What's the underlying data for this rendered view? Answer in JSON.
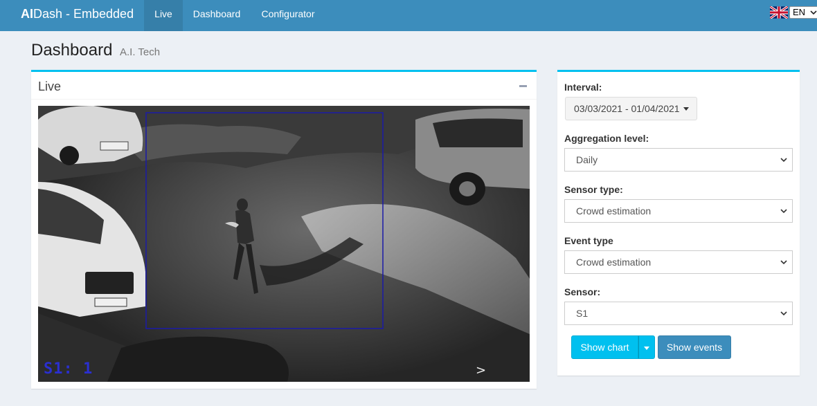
{
  "app": {
    "brand_bold": "AI",
    "brand_rest": "Dash - Embedded"
  },
  "nav": {
    "items": [
      {
        "label": "Live",
        "active": true
      },
      {
        "label": "Dashboard",
        "active": false
      },
      {
        "label": "Configurator",
        "active": false
      }
    ],
    "language": {
      "selected": "EN",
      "flag": "uk-flag-icon"
    }
  },
  "page": {
    "title": "Dashboard",
    "subtitle": "A.I. Tech"
  },
  "live_box": {
    "title": "Live",
    "overlay_label": "S1: 1",
    "overlay_marker": ">"
  },
  "filters": {
    "interval": {
      "label": "Interval:",
      "value": "03/03/2021 - 01/04/2021"
    },
    "aggregation": {
      "label": "Aggregation level:",
      "value": "Daily"
    },
    "sensor_type": {
      "label": "Sensor type:",
      "value": "Crowd estimation"
    },
    "event_type": {
      "label": "Event type",
      "value": "Crowd estimation"
    },
    "sensor": {
      "label": "Sensor:",
      "value": "S1"
    },
    "show_chart_label": "Show chart",
    "show_events_label": "Show events"
  },
  "colors": {
    "navbar": "#3c8dbc",
    "navbar_active": "#367fa9",
    "accent": "#00c0ef",
    "primary_button": "#3c8dbc",
    "roi_box": "#1a1aa8",
    "overlay_text": "#2a2fd0"
  }
}
